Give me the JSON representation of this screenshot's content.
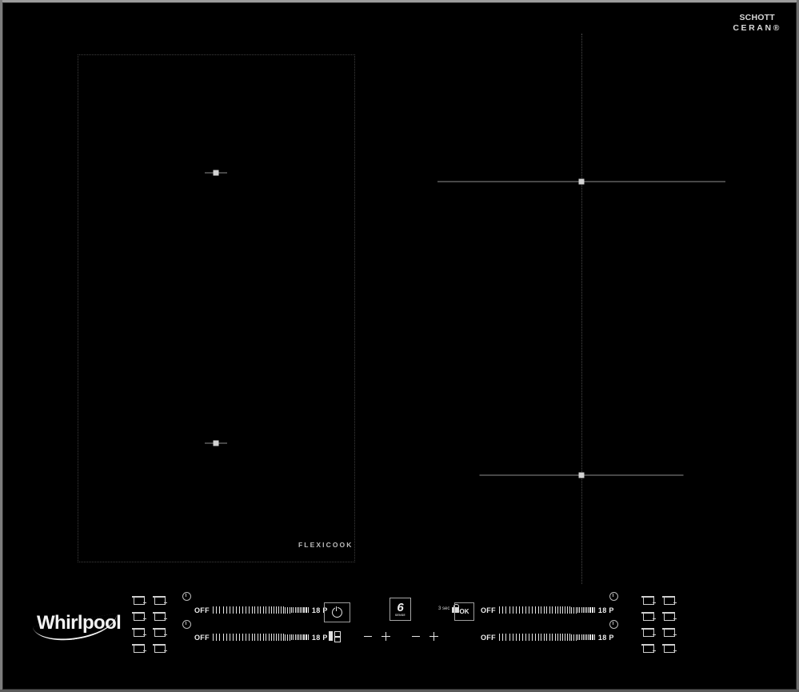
{
  "device": {
    "brand": "Whirlpool",
    "glass_brand_line1": "SCHOTT",
    "glass_brand_line2": "CERAN®",
    "flexicook_label": "FLEXICOOK"
  },
  "controls": {
    "power_button_label": "",
    "power_icon": "power-icon",
    "sixth_sense": {
      "digit": "6",
      "caption": "SENSE"
    },
    "lock": {
      "hold_label": "3 sec",
      "icon": "lock-icon"
    },
    "ok_button_label": "OK",
    "display_icon": "display-icon",
    "minus_label": "−",
    "plus_label": "+"
  },
  "sliders": [
    {
      "id": "front-left",
      "off_label": "OFF",
      "max_label": "18 P",
      "timer_icon": "clock-icon"
    },
    {
      "id": "rear-left",
      "off_label": "OFF",
      "max_label": "18 P",
      "timer_icon": "clock-icon"
    },
    {
      "id": "front-right",
      "off_label": "OFF",
      "max_label": "18 P",
      "timer_icon": "clock-icon"
    },
    {
      "id": "rear-right",
      "off_label": "OFF",
      "max_label": "18 P",
      "timer_icon": "clock-icon"
    }
  ],
  "colors": {
    "glass": "#000000",
    "bezel": "#9c9c9c",
    "text": "#ededed",
    "zone_outline": "#3e3e3e",
    "marker": "#d2d2d2"
  }
}
